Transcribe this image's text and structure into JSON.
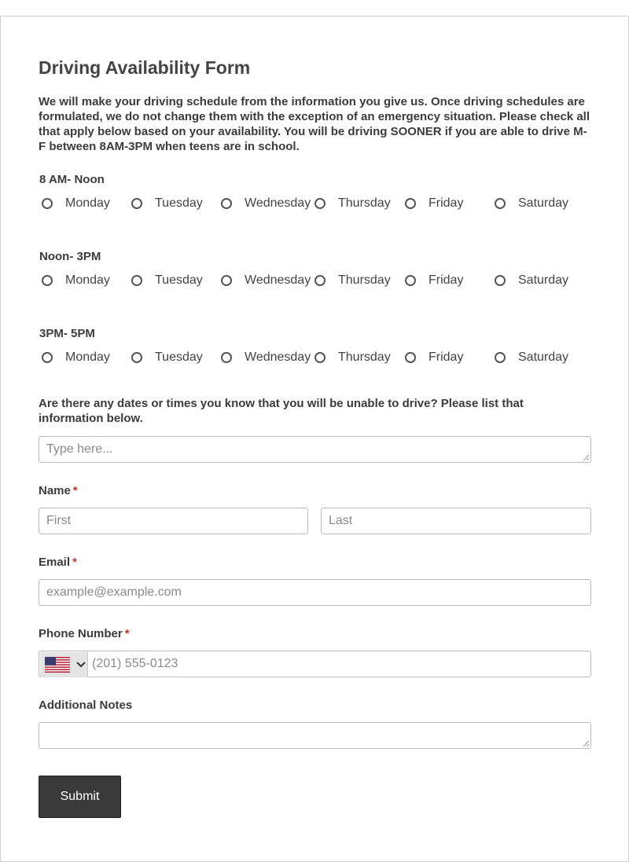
{
  "form": {
    "title": "Driving Availability Form",
    "intro": "We will make your driving schedule from the information you give us. Once driving schedules are formulated, we do not change them with the exception of an emergency situation. Please check all that apply below based on your availability. You will be driving SOONER if you are able to drive M-F between 8AM-3PM when teens are in school."
  },
  "availability": {
    "groups": [
      {
        "label": "8 AM- Noon",
        "days": [
          "Monday",
          "Tuesday",
          "Wednesday",
          "Thursday",
          "Friday",
          "Saturday"
        ]
      },
      {
        "label": "Noon- 3PM",
        "days": [
          "Monday",
          "Tuesday",
          "Wednesday",
          "Thursday",
          "Friday",
          "Saturday"
        ]
      },
      {
        "label": "3PM- 5PM",
        "days": [
          "Monday",
          "Tuesday",
          "Wednesday",
          "Thursday",
          "Friday",
          "Saturday"
        ]
      }
    ]
  },
  "unavailable": {
    "question": "Are there any dates or times you know that you will be unable to drive? Please list that information below.",
    "placeholder": "Type here..."
  },
  "name": {
    "label": "Name",
    "required": "*",
    "first_placeholder": "First",
    "last_placeholder": "Last"
  },
  "email": {
    "label": "Email",
    "required": "*",
    "placeholder": "example@example.com"
  },
  "phone": {
    "label": "Phone Number",
    "required": "*",
    "placeholder": "(201) 555-0123",
    "country_icon": "us-flag-icon"
  },
  "notes": {
    "label": "Additional Notes"
  },
  "submit_label": "Submit",
  "colors": {
    "required": "#c0392b",
    "submit_bg": "#3a3a3a"
  }
}
